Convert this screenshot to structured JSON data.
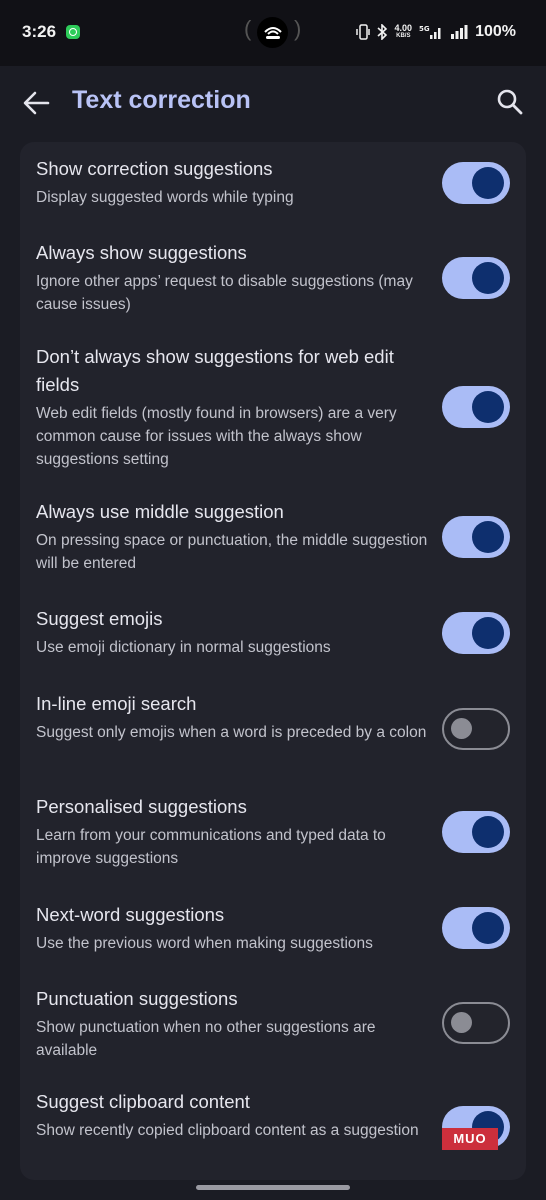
{
  "status_bar": {
    "time": "3:26",
    "speed_value": "4.00",
    "speed_unit": "KB/S",
    "battery": "100%",
    "icons": [
      "whatsapp-icon",
      "hotspot-icon",
      "vibrate-icon",
      "bluetooth-icon",
      "5g-signal-icon",
      "signal-icon"
    ]
  },
  "app_bar": {
    "title": "Text correction",
    "back_icon": "arrow-left-icon",
    "search_icon": "search-icon"
  },
  "colors": {
    "background": "#1b1c24",
    "card": "#22232c",
    "title_accent": "#b9c3f6",
    "toggle_on_track": "#aabcf6",
    "toggle_on_knob": "#0e2f6e",
    "toggle_off_outline": "#8b8c94"
  },
  "settings": [
    {
      "title": "Show correction suggestions",
      "desc": "Display suggested words while typing",
      "enabled": true
    },
    {
      "title": "Always show suggestions",
      "desc": "Ignore other apps’ request to disable suggestions (may cause issues)",
      "enabled": true
    },
    {
      "title": "Don’t always show suggestions for web edit fields",
      "desc": "Web edit fields (mostly found in browsers) are a very common cause for issues with the always show suggestions setting",
      "enabled": true
    },
    {
      "title": "Always use middle suggestion",
      "desc": "On pressing space or punctuation, the middle suggestion will be entered",
      "enabled": true
    },
    {
      "title": "Suggest emojis",
      "desc": "Use emoji dictionary in normal suggestions",
      "enabled": true
    },
    {
      "title": "In-line emoji search",
      "desc": "Suggest only emojis when a word is preceded by a colon",
      "enabled": false
    },
    {
      "title": "Personalised suggestions",
      "desc": "Learn from your communications and typed data to improve suggestions",
      "enabled": true
    },
    {
      "title": "Next-word suggestions",
      "desc": "Use the previous word when making suggestions",
      "enabled": true
    },
    {
      "title": "Punctuation suggestions",
      "desc": "Show punctuation when no other suggestions are available",
      "enabled": false
    },
    {
      "title": "Suggest clipboard content",
      "desc": "Show recently copied clipboard content as a suggestion",
      "enabled": true
    }
  ],
  "watermark": "MUO"
}
